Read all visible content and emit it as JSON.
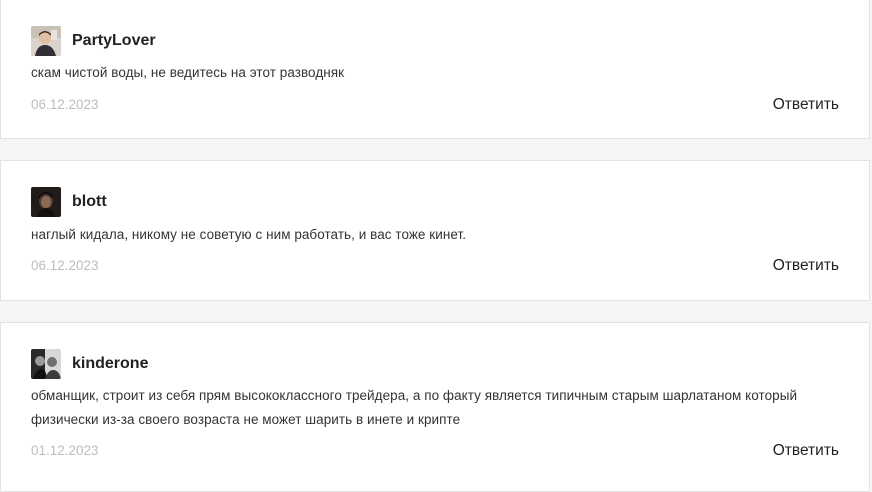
{
  "comments": [
    {
      "author": "PartyLover",
      "avatar_icon": "user-avatar-photo",
      "text": "скам чистой воды, не ведитесь на этот разводняк",
      "date": "06.12.2023",
      "reply_label": "Ответить"
    },
    {
      "author": "blott",
      "avatar_icon": "user-avatar-photo",
      "text": "наглый кидала, никому не советую с ним работать, и вас тоже кинет.",
      "date": "06.12.2023",
      "reply_label": "Ответить"
    },
    {
      "author": "kinderone",
      "avatar_icon": "user-avatar-photo",
      "text": "обманщик, строит из себя прям высококлассного трейдера, а по факту является типичным старым шарлатаном который физически из-за своего возраста не может шарить в инете и крипте",
      "date": "01.12.2023",
      "reply_label": "Ответить"
    }
  ],
  "colors": {
    "page_background": "#f5f5f3",
    "card_background": "#ffffff",
    "card_border": "#e2e2e0",
    "date_text": "#bdbdbd"
  }
}
